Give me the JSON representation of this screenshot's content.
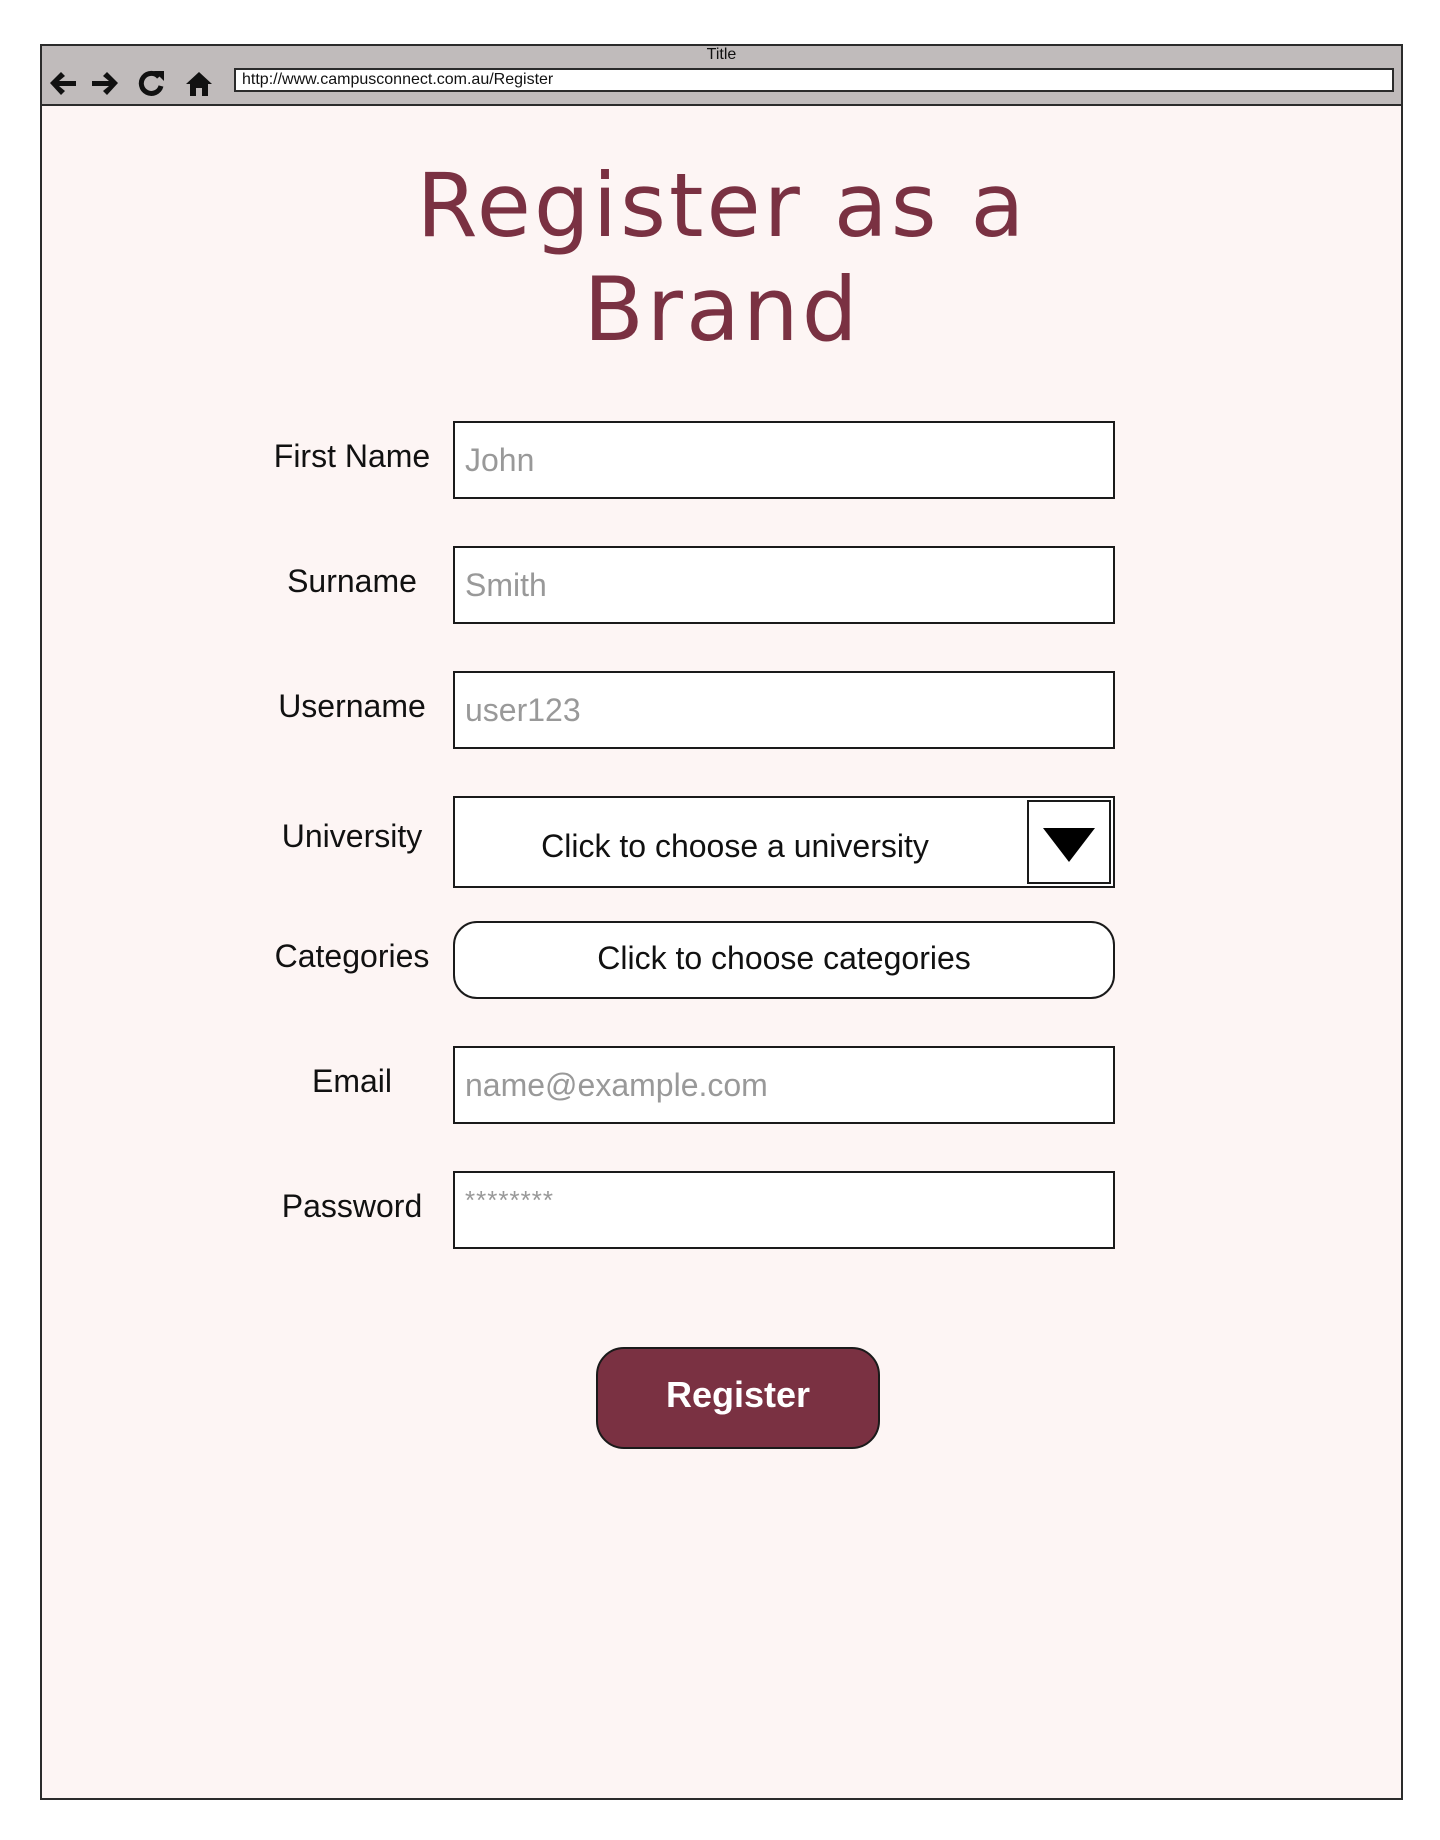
{
  "browser": {
    "title": "Title",
    "url": "http://www.campusconnect.com.au/Register",
    "icons": [
      "back-arrow-icon",
      "forward-arrow-icon",
      "refresh-icon",
      "home-icon"
    ]
  },
  "page": {
    "title_line1": "Register as a",
    "title_line2": "Brand"
  },
  "form": {
    "first_name": {
      "label": "First Name",
      "placeholder": "John"
    },
    "surname": {
      "label": "Surname",
      "placeholder": "Smith"
    },
    "username": {
      "label": "Username",
      "placeholder": "user123"
    },
    "university": {
      "label": "University",
      "value": "Click to choose a university",
      "icon": "dropdown-arrow-icon"
    },
    "categories": {
      "label": "Categories",
      "button_label": "Click to choose categories"
    },
    "email": {
      "label": "Email",
      "placeholder": "name@example.com"
    },
    "password": {
      "label": "Password",
      "placeholder": "********"
    },
    "submit_label": "Register"
  },
  "colors": {
    "brand": "#7a3142",
    "background": "#fdf5f4",
    "chrome": "#c0bbbb",
    "placeholder": "#999999"
  }
}
